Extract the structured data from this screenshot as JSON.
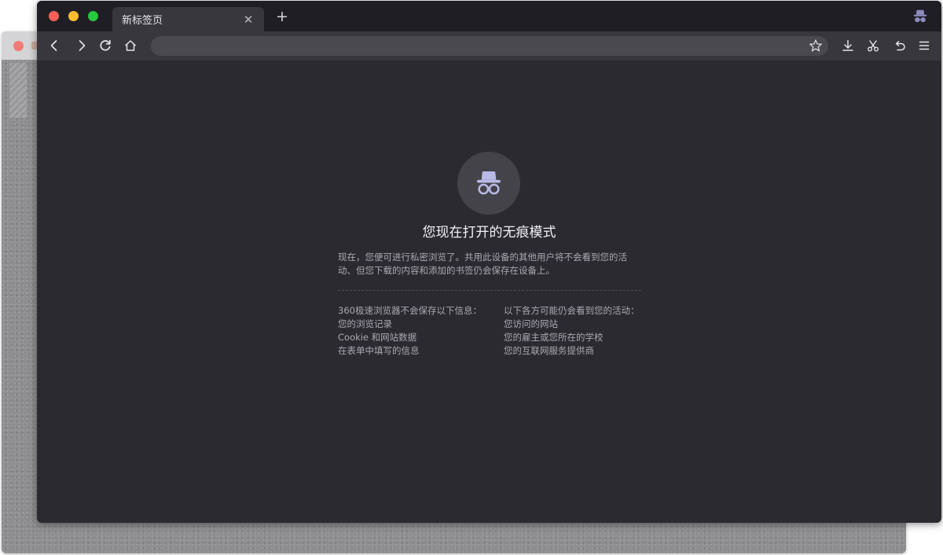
{
  "browser": {
    "tab": {
      "title": "新标签页"
    },
    "address_bar": {
      "value": "",
      "placeholder": ""
    }
  },
  "icons": {
    "back": "chevron-left-icon",
    "forward": "chevron-right-icon",
    "reload": "reload-icon",
    "home": "home-icon",
    "bookmark": "star-icon",
    "download": "download-icon",
    "screenshot": "scissors-icon",
    "undo": "undo-icon",
    "menu": "menu-icon",
    "incognito": "incognito-icon"
  },
  "incognito_page": {
    "heading": "您现在打开的无痕模式",
    "description_lines": [
      "现在，您便可进行私密浏览了。共用此设备的其他用户将不会看到您的活",
      "动、但您下载的内容和添加的书签仍会保存在设备上。"
    ],
    "not_saved": {
      "title": "360极速浏览器不会保存以下信息：",
      "items": [
        "您的浏览记录",
        "Cookie 和网站数据",
        "在表单中填写的信息"
      ]
    },
    "still_visible": {
      "title": "以下各方可能仍会看到您的活动：",
      "items": [
        "您访问的网站",
        "您的雇主或您所在的学校",
        "您的互联网服务提供商"
      ]
    }
  },
  "colors": {
    "content_bg": "#2b2a31",
    "tabbar_bg": "#1f1e24",
    "toolbar_bg": "#38373e",
    "icon_accent": "#b9b9e6",
    "close_dot": "#fe5f57",
    "minimize_dot": "#febc2e",
    "maximize_dot": "#28c840"
  }
}
